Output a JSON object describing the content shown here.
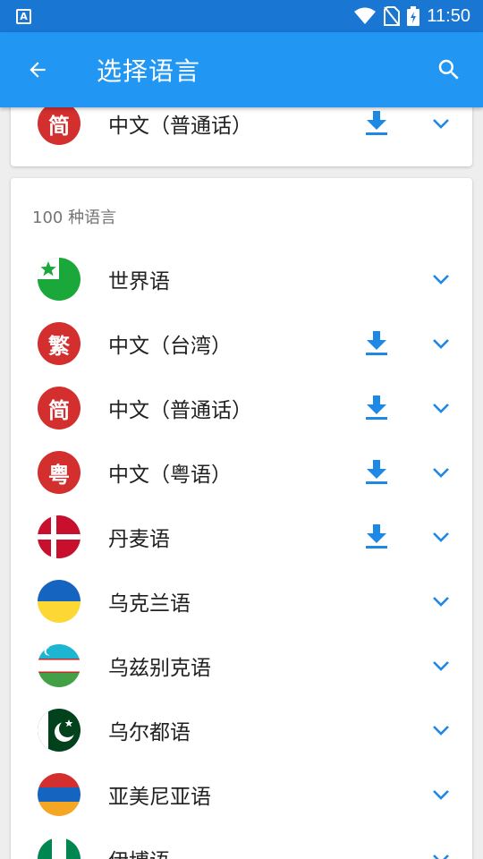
{
  "status": {
    "time": "11:50",
    "app_icon_letter": "A"
  },
  "appbar": {
    "title": "选择语言"
  },
  "top_item": {
    "name": "中文（普通话）",
    "flag_char": "简"
  },
  "list": {
    "count_label": "100 种语言",
    "items": [
      {
        "name": "世界语"
      },
      {
        "name": "中文（台湾）",
        "flag_char": "繁"
      },
      {
        "name": "中文（普通话）",
        "flag_char": "简"
      },
      {
        "name": "中文（粤语）",
        "flag_char": "粤"
      },
      {
        "name": "丹麦语"
      },
      {
        "name": "乌克兰语"
      },
      {
        "name": "乌兹别克语"
      },
      {
        "name": "乌尔都语"
      },
      {
        "name": "亚美尼亚语"
      },
      {
        "name": "伊博语"
      }
    ]
  },
  "colors": {
    "primary": "#2196f3",
    "status": "#1976d2",
    "accent": "#1e88e5",
    "badge_red": "#d32f2f"
  },
  "icons": {
    "back": "arrow-left-icon",
    "search": "search-icon",
    "download": "download-icon",
    "expand": "chevron-down-icon"
  }
}
